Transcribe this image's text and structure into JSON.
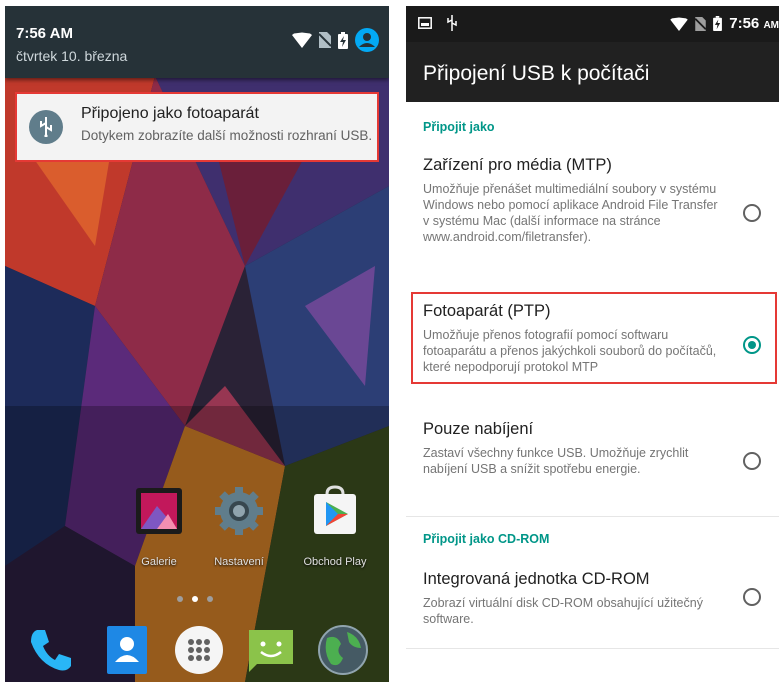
{
  "left_phone": {
    "time": "7:56 AM",
    "date": "čtvrtek 10. března",
    "status_icons": [
      "wifi-icon",
      "no-sim-icon",
      "battery-charging-icon",
      "account-icon"
    ],
    "notification": {
      "icon": "usb-icon",
      "title": "Připojeno jako fotoaparát",
      "text": "Dotykem zobrazíte další možnosti rozhraní USB."
    },
    "apps": [
      {
        "label": "Galerie",
        "icon": "gallery-icon"
      },
      {
        "label": "Nastavení",
        "icon": "settings-icon"
      },
      {
        "label": "Obchod Play",
        "icon": "play-store-icon"
      }
    ],
    "dock": [
      "phone-icon",
      "contacts-icon",
      "app-drawer-icon",
      "messaging-icon",
      "browser-icon"
    ]
  },
  "right_phone": {
    "status": {
      "left_icons": [
        "screenshot-icon",
        "usb-icon"
      ],
      "right_icons": [
        "wifi-icon",
        "no-sim-icon",
        "battery-charging-icon"
      ],
      "time": "7:56",
      "ampm": "AM"
    },
    "title": "Připojení USB k počítači",
    "section1": "Připojit jako",
    "options": [
      {
        "title": "Zařízení pro média (MTP)",
        "desc": "Umožňuje přenášet multimediální soubory v systému Windows nebo pomocí aplikace Android File Transfer v systému Mac (další informace na stránce www.android.com/filetransfer).",
        "selected": false
      },
      {
        "title": "Fotoaparát (PTP)",
        "desc": "Umožňuje přenos fotografií pomocí softwaru fotoaparátu a přenos jakýchkoli souborů do počítačů, které nepodporují protokol MTP",
        "selected": true
      },
      {
        "title": "Pouze nabíjení",
        "desc": "Zastaví všechny funkce USB. Umožňuje zrychlit nabíjení USB a snížit spotřebu energie.",
        "selected": false
      }
    ],
    "section2": "Připojit jako CD-ROM",
    "cdrom": {
      "title": "Integrovaná jednotka CD-ROM",
      "desc": "Zobrazí virtuální disk CD-ROM obsahující užitečný software.",
      "selected": false
    }
  },
  "colors": {
    "accent": "#009688",
    "highlight": "#e53935",
    "appbar": "#212121",
    "shade": "#263238"
  }
}
